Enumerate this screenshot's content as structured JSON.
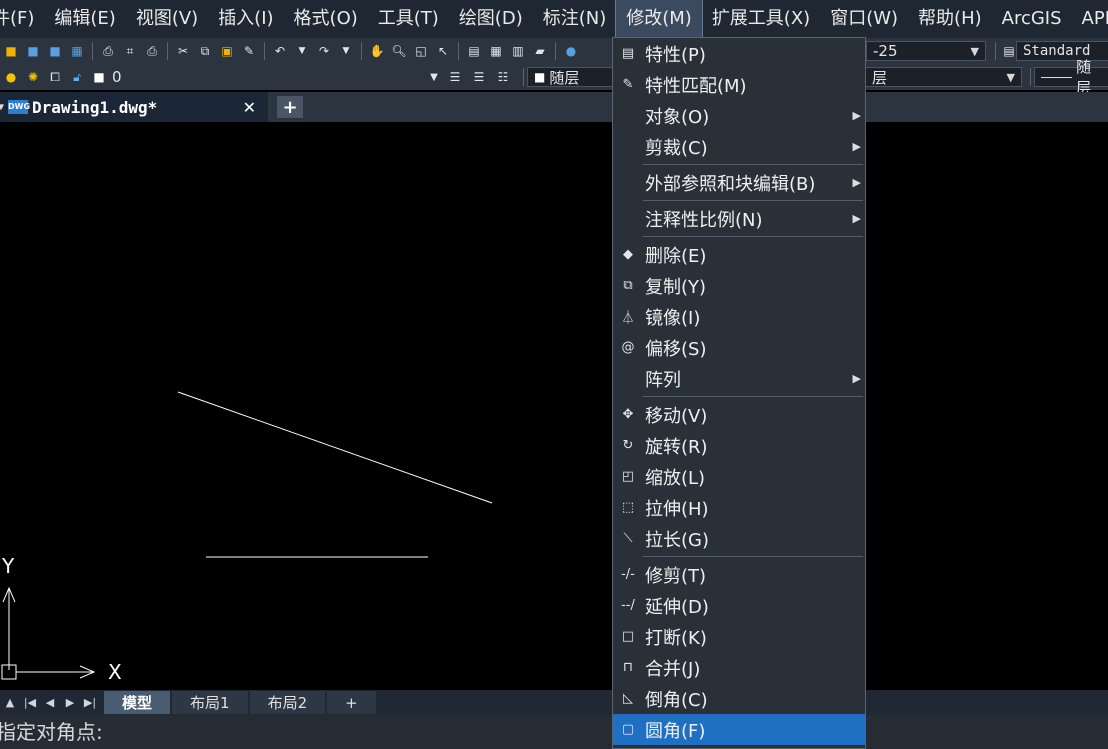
{
  "menubar": {
    "items": [
      "件(F)",
      "编辑(E)",
      "视图(V)",
      "插入(I)",
      "格式(O)",
      "工具(T)",
      "绘图(D)",
      "标注(N)",
      "修改(M)",
      "扩展工具(X)",
      "窗口(W)",
      "帮助(H)",
      "ArcGIS",
      "APP"
    ]
  },
  "toolbar": {
    "dimstyle_value": "-25",
    "textstyle_value": "Standard",
    "layer_value": "0",
    "color_value": "随层",
    "linetype_value": "层",
    "lineweight_value": "随层"
  },
  "doc_tab": {
    "title": "Drawing1.dwg*",
    "close": "✕",
    "add": "+"
  },
  "canvas": {
    "y_axis_label": "Y",
    "x_axis_label": "X"
  },
  "layout_tabs": [
    "模型",
    "布局1",
    "布局2",
    "+"
  ],
  "command_line": "指定对角点:",
  "modify_menu": {
    "items": [
      {
        "label": "特性(P)",
        "icon": "properties-icon",
        "glyph": "▤"
      },
      {
        "label": "特性匹配(M)",
        "icon": "match-properties-icon",
        "glyph": "✎"
      },
      {
        "label": "对象(O)",
        "submenu": true
      },
      {
        "label": "剪裁(C)",
        "submenu": true
      },
      {
        "sep": true
      },
      {
        "label": "外部参照和块编辑(B)",
        "submenu": true
      },
      {
        "sep": true
      },
      {
        "label": "注释性比例(N)",
        "submenu": true
      },
      {
        "sep": true
      },
      {
        "label": "删除(E)",
        "icon": "erase-icon",
        "glyph": "◆"
      },
      {
        "label": "复制(Y)",
        "icon": "copy-icon",
        "glyph": "⧉"
      },
      {
        "label": "镜像(I)",
        "icon": "mirror-icon",
        "glyph": "⏃"
      },
      {
        "label": "偏移(S)",
        "icon": "offset-icon",
        "glyph": "@"
      },
      {
        "label": "阵列",
        "submenu": true
      },
      {
        "sep": true
      },
      {
        "label": "移动(V)",
        "icon": "move-icon",
        "glyph": "✥"
      },
      {
        "label": "旋转(R)",
        "icon": "rotate-icon",
        "glyph": "↻"
      },
      {
        "label": "缩放(L)",
        "icon": "scale-icon",
        "glyph": "◰"
      },
      {
        "label": "拉伸(H)",
        "icon": "stretch-icon",
        "glyph": "⬚"
      },
      {
        "label": "拉长(G)",
        "icon": "lengthen-icon",
        "glyph": "⟍"
      },
      {
        "sep": true
      },
      {
        "label": "修剪(T)",
        "icon": "trim-icon",
        "glyph": "-/-"
      },
      {
        "label": "延伸(D)",
        "icon": "extend-icon",
        "glyph": "--/"
      },
      {
        "label": "打断(K)",
        "icon": "break-icon",
        "glyph": "□"
      },
      {
        "label": "合并(J)",
        "icon": "join-icon",
        "glyph": "⊓"
      },
      {
        "label": "倒角(C)",
        "icon": "chamfer-icon",
        "glyph": "◺"
      },
      {
        "label": "圆角(F)",
        "icon": "fillet-icon",
        "glyph": "▢",
        "highlighted": true
      }
    ]
  }
}
